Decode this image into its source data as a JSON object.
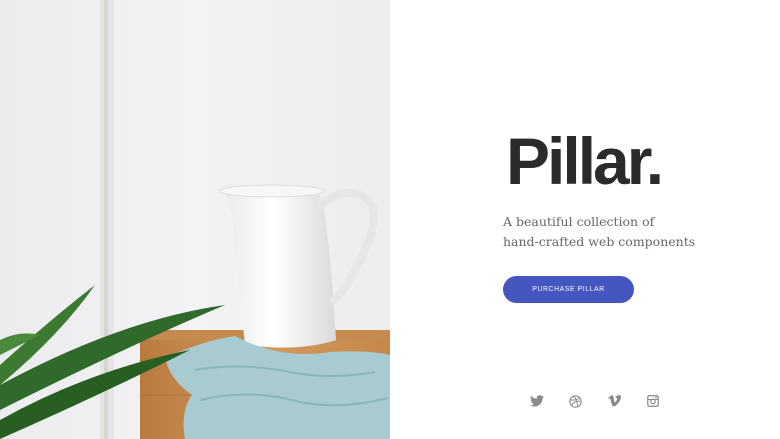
{
  "hero": {
    "image_alt": "White ceramic pitcher on wooden stool with light blue cloth and green plant leaves",
    "image_icon": "photo"
  },
  "brand": {
    "name": "Pillar."
  },
  "tagline": {
    "line1": "A beautiful collection of",
    "line2": "hand-crafted web components"
  },
  "cta": {
    "label": "PURCHASE PILLAR",
    "color": "#4656c0"
  },
  "social": [
    {
      "icon": "twitter-icon"
    },
    {
      "icon": "dribbble-icon"
    },
    {
      "icon": "vimeo-icon"
    },
    {
      "icon": "instagram-icon"
    }
  ],
  "colors": {
    "text_dark": "#2b2b2b",
    "text_muted": "#666666",
    "icon": "#8a8a8a"
  }
}
